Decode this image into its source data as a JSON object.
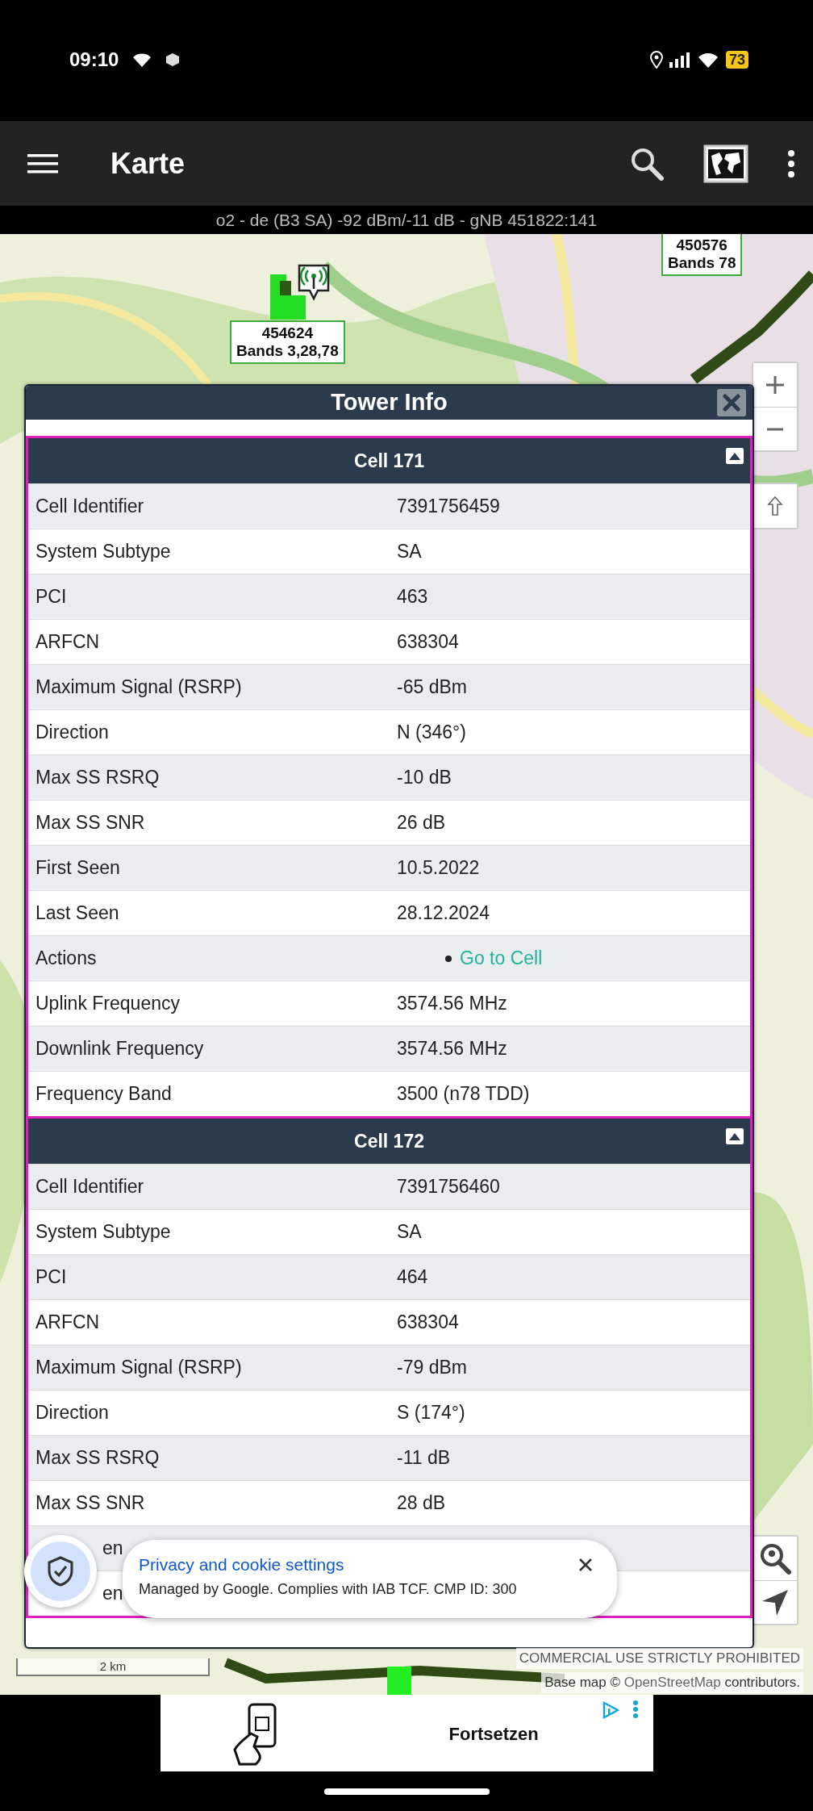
{
  "status_bar": {
    "time": "09:10",
    "battery": "73"
  },
  "toolbar": {
    "title": "Karte"
  },
  "connection_info": "o2 - de (B3 SA) -92 dBm/-11 dB - gNB 451822:141",
  "map": {
    "markers": [
      {
        "cell_id": "454624",
        "bands": "Bands 3,28,78",
        "kind": "tower"
      },
      {
        "cell_id": "450576",
        "bands": "Bands 78",
        "kind": "label"
      }
    ],
    "scale": "2 km",
    "notice": "COMMERCIAL USE STRICTLY PROHIBITED",
    "attribution": {
      "prefix": "Base map ©",
      "link": "OpenStreetMap",
      "suffix": "contributors."
    }
  },
  "dialog": {
    "title": "Tower Info",
    "cells": [
      {
        "title": "Cell 171",
        "expanded": true,
        "rows": [
          {
            "kind": "text",
            "label": "Cell Identifier",
            "value": "7391756459"
          },
          {
            "kind": "text",
            "label": "System Subtype",
            "value": "SA"
          },
          {
            "kind": "text",
            "label": "PCI",
            "value": "463"
          },
          {
            "kind": "text",
            "label": "ARFCN",
            "value": "638304"
          },
          {
            "kind": "text",
            "label": "Maximum Signal (RSRP)",
            "value": "-65 dBm"
          },
          {
            "kind": "text",
            "label": "Direction",
            "value": "N (346°)"
          },
          {
            "kind": "text",
            "label": "Max SS RSRQ",
            "value": "-10 dB"
          },
          {
            "kind": "text",
            "label": "Max SS SNR",
            "value": "26 dB"
          },
          {
            "kind": "text",
            "label": "First Seen",
            "value": "10.5.2022"
          },
          {
            "kind": "text",
            "label": "Last Seen",
            "value": "28.12.2024"
          },
          {
            "kind": "actions",
            "label": "Actions",
            "links": [
              "Go to Cell"
            ]
          },
          {
            "kind": "text",
            "label": "Uplink Frequency",
            "value": "3574.56 MHz"
          },
          {
            "kind": "text",
            "label": "Downlink Frequency",
            "value": "3574.56 MHz"
          },
          {
            "kind": "text",
            "label": "Frequency Band",
            "value": "3500 (n78 TDD)"
          }
        ]
      },
      {
        "title": "Cell 172",
        "expanded": true,
        "rows": [
          {
            "kind": "text",
            "label": "Cell Identifier",
            "value": "7391756460"
          },
          {
            "kind": "text",
            "label": "System Subtype",
            "value": "SA"
          },
          {
            "kind": "text",
            "label": "PCI",
            "value": "464"
          },
          {
            "kind": "text",
            "label": "ARFCN",
            "value": "638304"
          },
          {
            "kind": "text",
            "label": "Maximum Signal (RSRP)",
            "value": "-79 dBm"
          },
          {
            "kind": "text",
            "label": "Direction",
            "value": "S (174°)"
          },
          {
            "kind": "text",
            "label": "Max SS RSRQ",
            "value": "-11 dB"
          },
          {
            "kind": "text",
            "label": "Max SS SNR",
            "value": "28 dB"
          },
          {
            "kind": "covered",
            "label": "en"
          },
          {
            "kind": "covered",
            "label": "en"
          }
        ]
      }
    ]
  },
  "cookie_banner": {
    "title": "Privacy and cookie settings",
    "text": "Managed by Google. Complies with IAB TCF. CMP ID: 300"
  },
  "ad": {
    "button": "Fortsetzen"
  }
}
